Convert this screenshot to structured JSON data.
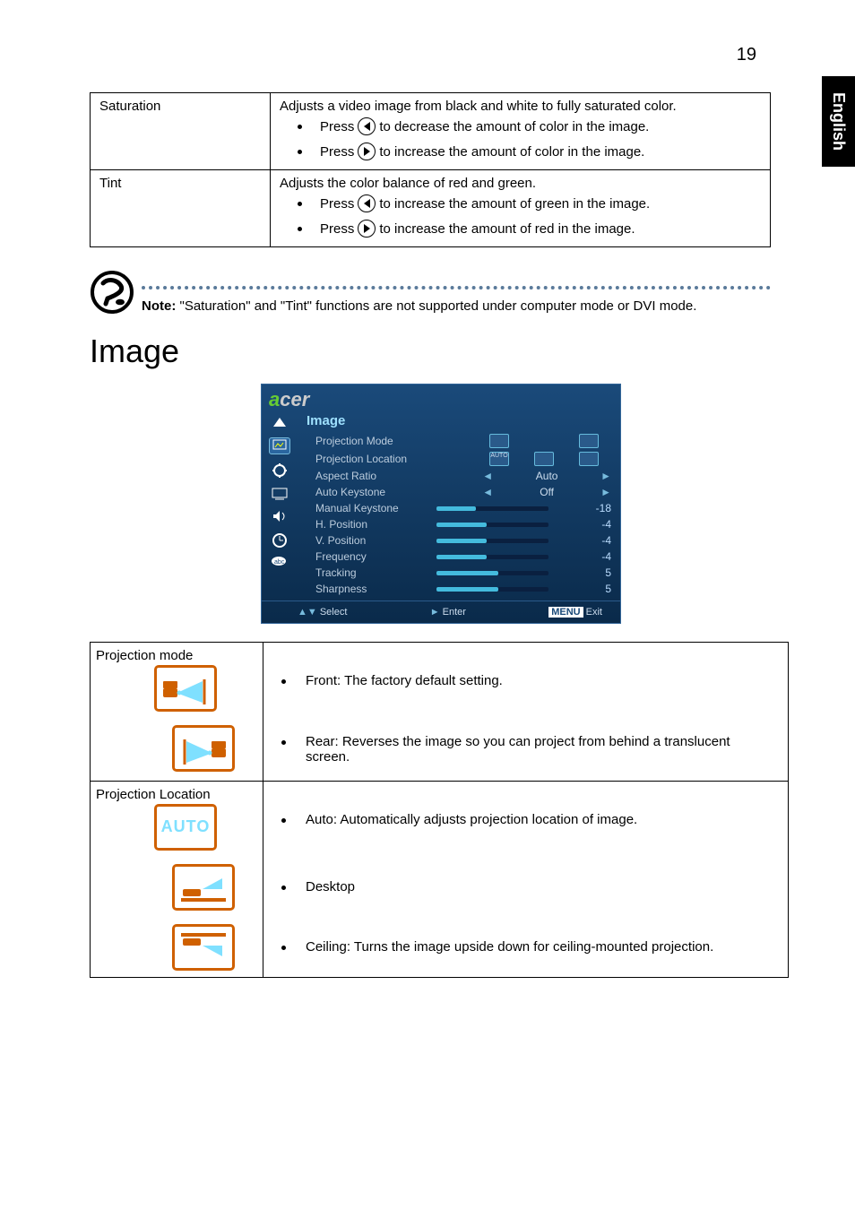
{
  "page_number": "19",
  "side_tab": "English",
  "table1": {
    "row1": {
      "label": "Saturation",
      "desc": "Adjusts a video image from black and white to fully saturated color.",
      "b1_pre": "Press ",
      "b1_post": " to decrease the amount of color in the image.",
      "b2_pre": "Press ",
      "b2_post": " to increase the amount of color in the image."
    },
    "row2": {
      "label": "Tint",
      "desc": "Adjusts the color balance of red and green.",
      "b1_pre": "Press ",
      "b1_post": " to increase the amount of green in the image.",
      "b2_pre": "Press ",
      "b2_post": " to increase the amount of red in the image."
    }
  },
  "note": {
    "label": "Note:",
    "text": " \"Saturation\" and \"Tint\" functions are not supported under computer mode or DVI mode."
  },
  "section_title": "Image",
  "osd": {
    "logo_a": "a",
    "logo_rest": "cer",
    "title": "Image",
    "rows": [
      {
        "k": "Projection Mode"
      },
      {
        "k": "Projection Location",
        "v": "AUTO"
      },
      {
        "k": "Aspect Ratio",
        "v": "Auto"
      },
      {
        "k": "Auto Keystone",
        "v": "Off"
      },
      {
        "k": "Manual Keystone",
        "n": "-18"
      },
      {
        "k": "H. Position",
        "n": "-4"
      },
      {
        "k": "V. Position",
        "n": "-4"
      },
      {
        "k": "Frequency",
        "n": "-4"
      },
      {
        "k": "Tracking",
        "n": "5"
      },
      {
        "k": "Sharpness",
        "n": "5"
      }
    ],
    "footer": {
      "select": "Select",
      "enter": "Enter",
      "menu": "MENU",
      "exit": "Exit"
    }
  },
  "proj": {
    "mode_label": "Projection mode",
    "front": "Front: The factory default setting.",
    "rear": "Rear: Reverses the image so you can project from behind a translucent screen.",
    "loc_label": "Projection Location",
    "auto_icon": "AUTO",
    "auto": "Auto: Automatically adjusts projection location of image.",
    "desktop": "Desktop",
    "ceiling": "Ceiling: Turns the image upside down for ceiling-mounted projection."
  }
}
